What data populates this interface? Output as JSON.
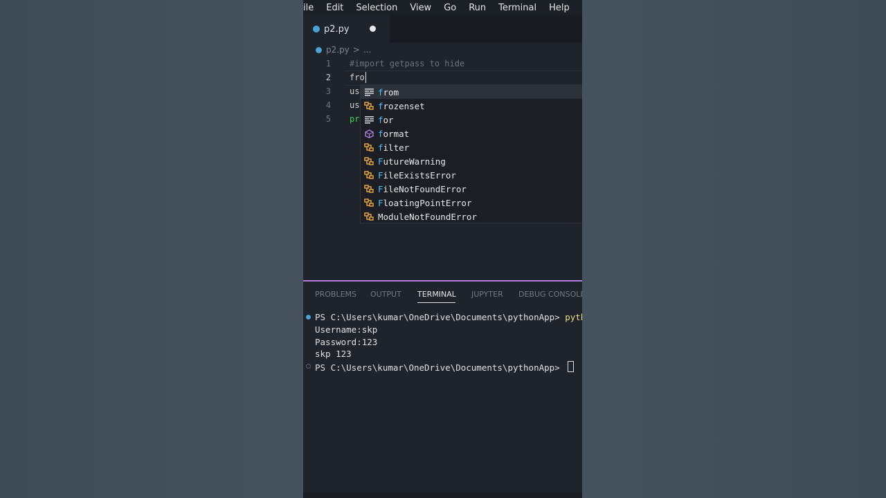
{
  "menu": [
    "ile",
    "Edit",
    "Selection",
    "View",
    "Go",
    "Run",
    "Terminal",
    "Help"
  ],
  "tab": {
    "name": "p2.py"
  },
  "breadcrumb": {
    "file": "p2.py",
    "sep": ">",
    "more": "..."
  },
  "editor": {
    "lines": [
      {
        "num": "1",
        "text": "#import getpass to hide"
      },
      {
        "num": "2",
        "text": "fro"
      },
      {
        "num": "3",
        "text": "us"
      },
      {
        "num": "4",
        "text": "us"
      },
      {
        "num": "5",
        "text": "pr"
      }
    ]
  },
  "suggestions": [
    {
      "prefix": "f",
      "rest": "rom",
      "icon": "keyword-icon"
    },
    {
      "prefix": "f",
      "rest": "rozenset",
      "icon": "class-icon"
    },
    {
      "prefix": "f",
      "rest": "or",
      "icon": "keyword-icon"
    },
    {
      "prefix": "f",
      "rest": "ormat",
      "icon": "function-icon"
    },
    {
      "prefix": "f",
      "rest": "ilter",
      "icon": "class-icon"
    },
    {
      "prefix": "F",
      "rest": "utureWarning",
      "icon": "class-icon"
    },
    {
      "prefix": "F",
      "rest": "ileExistsError",
      "icon": "class-icon"
    },
    {
      "prefix": "F",
      "rest": "ileNotFoundError",
      "icon": "class-icon"
    },
    {
      "prefix": "F",
      "rest": "loatingPointError",
      "icon": "class-icon"
    },
    {
      "prefix": "",
      "rest": "ModuleNotFoundError",
      "icon": "class-icon"
    }
  ],
  "panel": {
    "tabs": [
      "PROBLEMS",
      "OUTPUT",
      "TERMINAL",
      "JUPYTER",
      "DEBUG CONSOLE"
    ],
    "active_tab": "TERMINAL"
  },
  "terminal": {
    "prompt1": "PS C:\\Users\\kumar\\OneDrive\\Documents\\pythonApp> ",
    "cmd1": "pytho",
    "out1": "Username:skp",
    "out2": "Password:123",
    "out3": "skp 123",
    "prompt2": "PS C:\\Users\\kumar\\OneDrive\\Documents\\pythonApp> "
  },
  "colors": {
    "accent": "#b07bd9",
    "class_icon": "#e8a33d",
    "function_icon": "#b180d7",
    "python": "#4aa3d8"
  }
}
